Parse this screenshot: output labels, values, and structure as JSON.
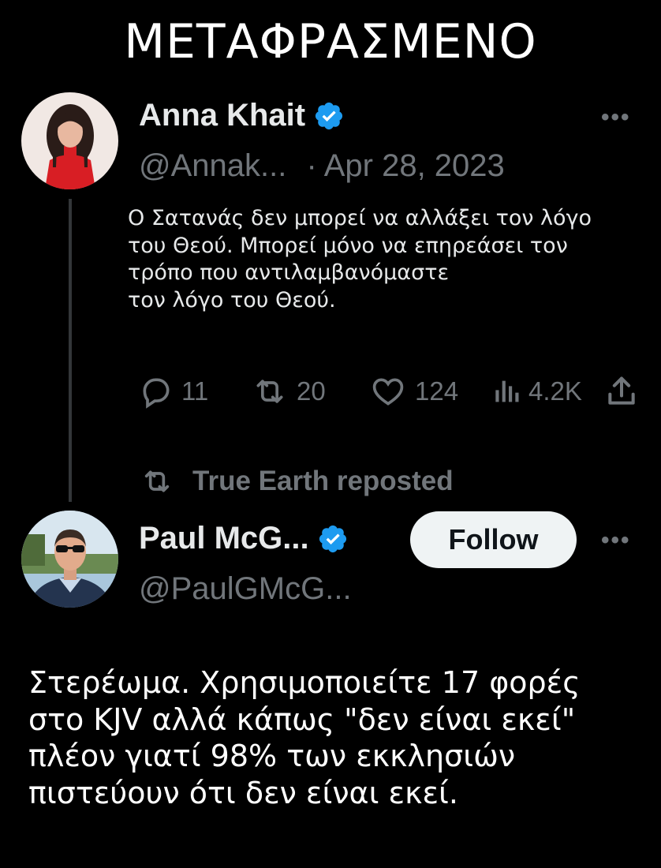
{
  "banner": {
    "title": "ΜΕΤΑΦΡΑΣΜΕΝΟ"
  },
  "tweet": {
    "author_name": "Anna Khait",
    "handle": "@Annak...",
    "date": "· Apr 28, 2023",
    "more_label": "•••",
    "text_lines": [
      "Ο Σατανάς δεν μπορεί να αλλάξει τον λόγο",
      "του Θεού. Μπορεί μόνο να επηρεάσει τον",
      "τρόπο που αντιλαμβανόμαστε",
      "τον λόγο του Θεού."
    ],
    "stats": {
      "replies": "11",
      "reposts": "20",
      "likes": "124",
      "views": "4.2K"
    }
  },
  "repost": {
    "label": "True Earth reposted"
  },
  "reply": {
    "author_name": "Paul McG...",
    "handle": "@PaulGMcG...",
    "follow_label": "Follow",
    "more_label": "•••"
  },
  "caption": {
    "lines": [
      "Στερέωμα. Χρησιμοποιείτε 17 φορές",
      "στο KJV αλλά κάπως \"δεν είναι εκεί\"",
      "πλέον γιατί 98% των εκκλησιών",
      "πιστεύουν ότι δεν είναι εκεί."
    ]
  },
  "colors": {
    "verified": "#1d9bf0",
    "muted": "#71767b",
    "background": "#000000"
  },
  "icons": [
    "verified-badge-icon",
    "reply-icon",
    "repost-icon",
    "like-icon",
    "views-icon",
    "share-icon",
    "more-icon"
  ]
}
